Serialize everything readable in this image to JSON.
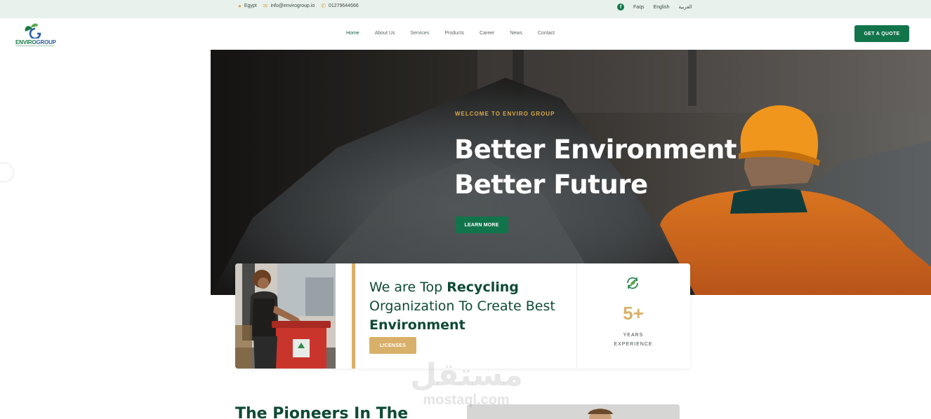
{
  "topbar": {
    "location": "Egypt",
    "email": "info@envirogroup.io",
    "phone": "01279644666",
    "faqs": "Faqs",
    "lang_en": "English",
    "lang_ar": "العربية"
  },
  "header": {
    "logo_text_a": "ENVIRO",
    "logo_text_b": "GROUP",
    "nav": [
      "Home",
      "About Us",
      "Services",
      "Products",
      "Career",
      "News",
      "Contact"
    ],
    "quote_button": "GET A QUOTE"
  },
  "hero": {
    "kicker": "WELCOME TO ENVIRO GROUP",
    "title": "Better Environment Better Future",
    "cta": "LEARN MORE"
  },
  "about_card": {
    "headline_a": "We are Top ",
    "headline_b": "Recycling",
    "headline_c": " Organization To Create Best ",
    "headline_d": "Environment",
    "licenses_button": "LICENSES",
    "stat_value": "5+",
    "stat_label_1": "YEARS",
    "stat_label_2": "EXPERIENCE"
  },
  "section": {
    "heading": "The Pioneers In The"
  },
  "watermark": {
    "arabic": "مستقل",
    "latin": "mostaql.com"
  },
  "colors": {
    "brand_green": "#12744a",
    "gold": "#d9b06a",
    "topbar_bg": "#e8f1ec"
  }
}
